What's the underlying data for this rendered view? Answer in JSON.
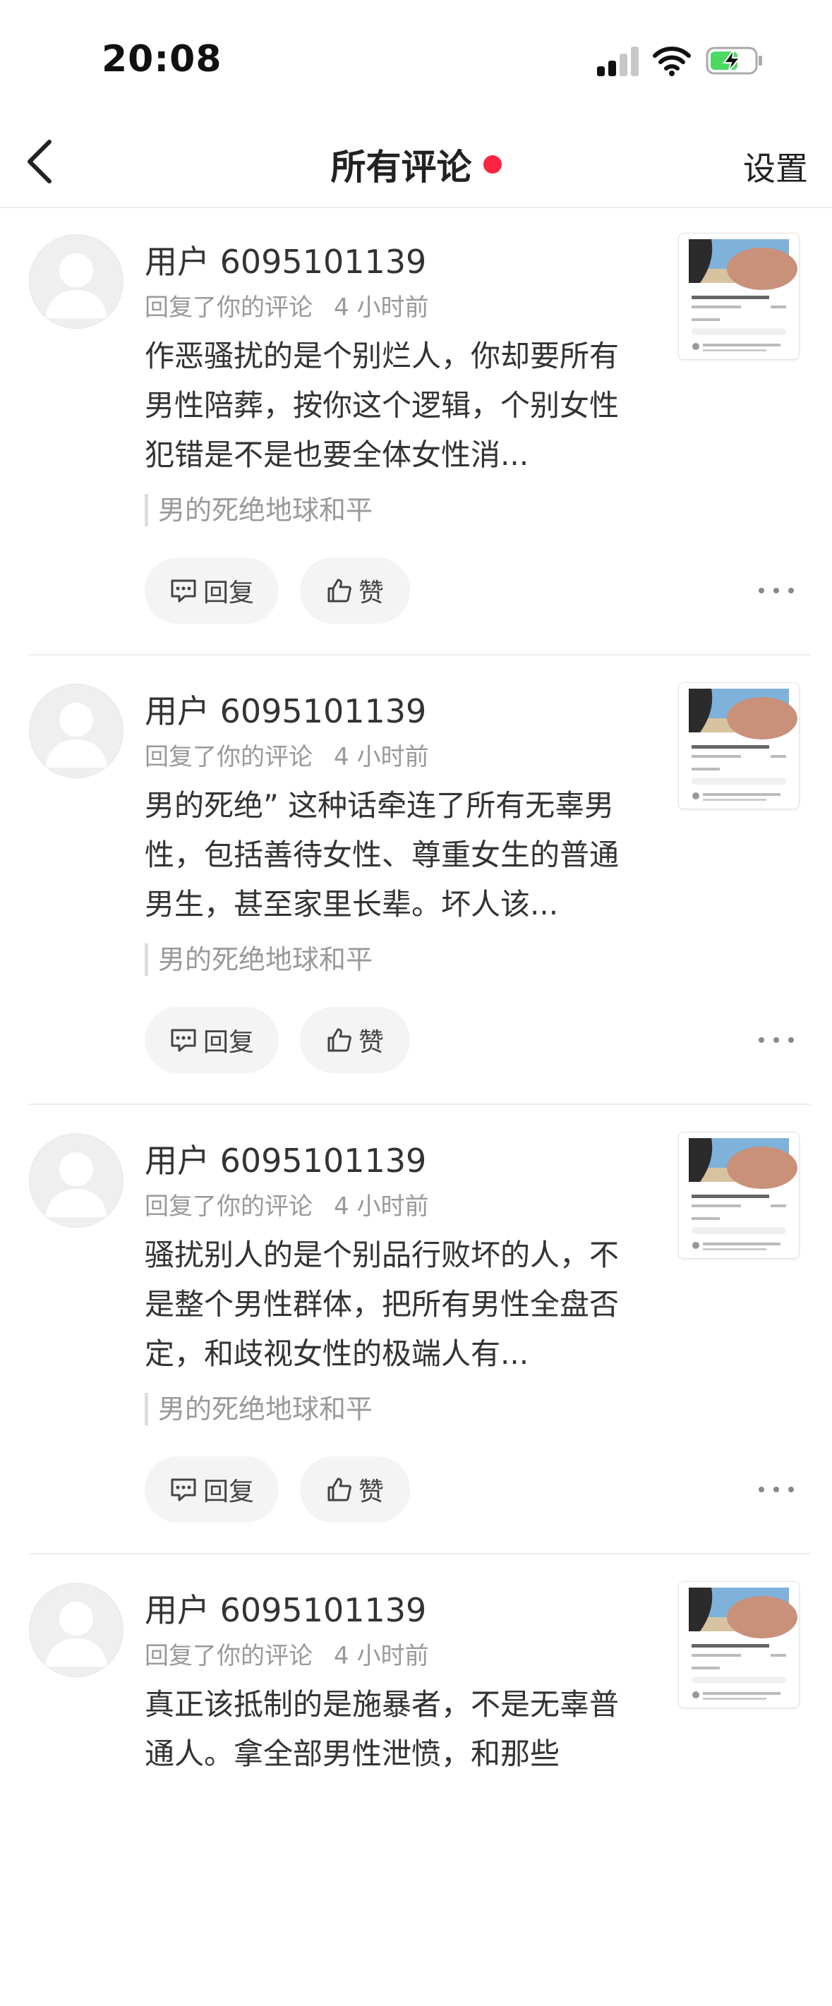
{
  "status_bar": {
    "time": "20:08",
    "icons": [
      "cellular-signal-icon",
      "wifi-icon",
      "battery-charging-icon"
    ],
    "battery_color": "#4cd964"
  },
  "nav": {
    "back_icon": "chevron-left-icon",
    "title": "所有评论",
    "settings_label": "设置",
    "dot_color": "#ff2442"
  },
  "comments": [
    {
      "username": "用户 6095101139",
      "action": "回复了你的评论",
      "time_ago": "4 小时前",
      "text": "作恶骚扰的是个别烂人，你却要所有男性陪葬，按你这个逻辑，个别女性犯错是不是也要全体女性消...",
      "quote": "男的死绝地球和平",
      "reply_label": "回复",
      "like_label": "赞"
    },
    {
      "username": "用户 6095101139",
      "action": "回复了你的评论",
      "time_ago": "4 小时前",
      "text": "男的死绝” 这种话牵连了所有无辜男性，包括善待女性、尊重女生的普通男生，甚至家里长辈。坏人该...",
      "quote": "男的死绝地球和平",
      "reply_label": "回复",
      "like_label": "赞"
    },
    {
      "username": "用户 6095101139",
      "action": "回复了你的评论",
      "time_ago": "4 小时前",
      "text": "骚扰别人的是个别品行败坏的人，不是整个男性群体，把所有男性全盘否定，和歧视女性的极端人有...",
      "quote": "男的死绝地球和平",
      "reply_label": "回复",
      "like_label": "赞"
    },
    {
      "username": "用户 6095101139",
      "action": "回复了你的评论",
      "time_ago": "4 小时前",
      "text": "真正该抵制的是施暴者，不是无辜普通人。拿全部男性泄愤，和那些",
      "quote": "",
      "reply_label": "",
      "like_label": ""
    }
  ],
  "accent_color": "#ff2442"
}
